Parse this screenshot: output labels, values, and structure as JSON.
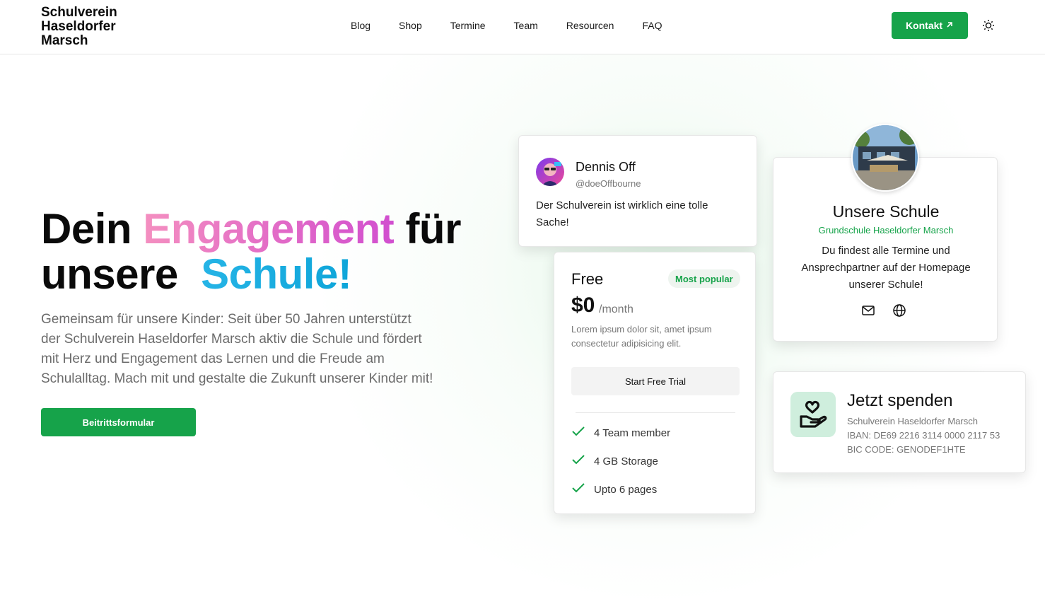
{
  "header": {
    "brand": "Schulverein\nHaseldorfer\nMarsch",
    "nav": [
      "Blog",
      "Shop",
      "Termine",
      "Team",
      "Resourcen",
      "FAQ"
    ],
    "contact_label": "Kontakt",
    "contact_icon": "arrow-up-right-icon",
    "theme_icon": "sun-icon"
  },
  "hero": {
    "title_part1": "Dein",
    "title_highlight1": "Engagement",
    "title_part2": "für",
    "title_part3": "unsere",
    "title_highlight2": "Schule!",
    "description": "Gemeinsam für unsere Kinder: Seit über 50 Jahren unterstützt der Schulverein Haseldorfer Marsch aktiv die Schule und fördert mit Herz und Engagement das Lernen und die Freude am Schulalltag. Mach mit und gestalte die Zukunft unserer Kinder mit!",
    "cta_label": "Beitrittsformular"
  },
  "testimonial": {
    "name": "Dennis Off",
    "handle": "@doeOffbourne",
    "quote": "Der Schulverein ist wirklich eine tolle Sache!"
  },
  "pricing": {
    "plan": "Free",
    "badge": "Most popular",
    "price": "$0",
    "unit": "/month",
    "description": "Lorem ipsum dolor sit, amet ipsum consectetur adipisicing elit.",
    "cta_label": "Start Free Trial",
    "features": [
      "4 Team member",
      "4 GB Storage",
      "Upto 6 pages"
    ]
  },
  "school": {
    "title": "Unsere Schule",
    "subtitle": "Grundschule Haseldorfer Marsch",
    "description": "Du findest alle Termine und Ansprechpartner auf der Homepage unserer Schule!",
    "icons": [
      "mail-icon",
      "globe-icon"
    ]
  },
  "donate": {
    "title": "Jetzt spenden",
    "recipient": "Schulverein Haseldorfer Marsch",
    "iban": "IBAN: DE69 2216 3114 0000 2117 53",
    "bic": "BIC CODE: GENODEF1HTE"
  },
  "colors": {
    "primary": "#16a34a",
    "pink_gradient": "#f48fc0",
    "blue_gradient": "#0ea5d9"
  }
}
